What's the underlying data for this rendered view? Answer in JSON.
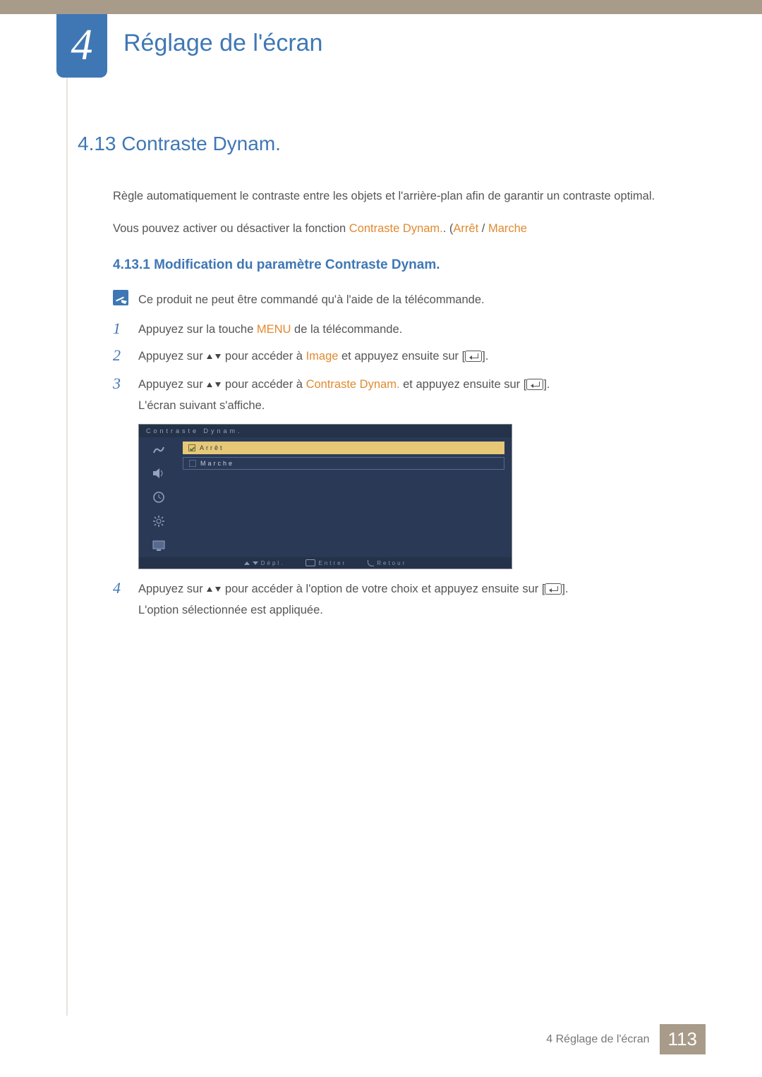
{
  "chapter": {
    "number": "4",
    "title": "Réglage de l'écran"
  },
  "section": {
    "number": "4.13",
    "title": "Contraste Dynam.",
    "heading": "4.13 Contraste Dynam.",
    "intro1": "Règle automatiquement le contraste entre les objets et l'arrière-plan afin de garantir un contraste optimal.",
    "intro2_pre": "Vous pouvez activer ou désactiver la fonction ",
    "intro2_hl1": "Contraste Dynam.",
    "intro2_mid": ". (",
    "intro2_hl2": "Arrêt",
    "intro2_sep": " / ",
    "intro2_hl3": "Marche"
  },
  "subsection": {
    "number": "4.13.1",
    "title": "Modification du paramètre Contraste Dynam.",
    "heading": "4.13.1 Modification du paramètre Contraste Dynam."
  },
  "note": "Ce produit ne peut être commandé qu'à l'aide de la télécommande.",
  "steps": [
    {
      "n": "1",
      "pre": "Appuyez sur la touche ",
      "hl": "MENU",
      "post": " de la télécommande."
    },
    {
      "n": "2",
      "pre": "Appuyez sur ",
      "mid": " pour accéder à ",
      "hl": "Image",
      "post": " et appuyez ensuite sur [",
      "tail": "]."
    },
    {
      "n": "3",
      "pre": "Appuyez sur ",
      "mid": " pour accéder à ",
      "hl": "Contraste Dynam.",
      "post": " et appuyez ensuite sur [",
      "tail": "].",
      "line2": "L'écran suivant s'affiche."
    },
    {
      "n": "4",
      "pre": "Appuyez sur ",
      "mid": " pour accéder à l'option de votre choix et appuyez ensuite sur [",
      "tail": "].",
      "line2": "L'option sélectionnée est appliquée."
    }
  ],
  "osd": {
    "title": "Contraste Dynam.",
    "options": [
      {
        "label": "Arrêt",
        "selected": true
      },
      {
        "label": "Marche",
        "selected": false
      }
    ],
    "footer": {
      "move": "Dépl.",
      "enter": "Entrer",
      "return": "Retour"
    }
  },
  "footer": {
    "text": "4 Réglage de l'écran",
    "page": "113"
  }
}
